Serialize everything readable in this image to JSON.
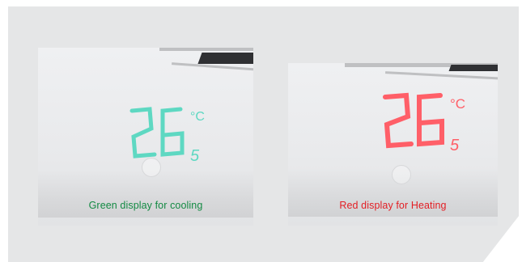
{
  "displays": [
    {
      "mode": "cooling",
      "caption": "Green display for cooling",
      "digits": "26",
      "decimal": "5",
      "unit": "°C",
      "digit_color": "#5ed8c2",
      "caption_color": "#138a43"
    },
    {
      "mode": "heating",
      "caption": "Red display for Heating",
      "digits": "26",
      "decimal": "5",
      "unit": "°C",
      "digit_color": "#ff5f68",
      "caption_color": "#e31e24"
    }
  ],
  "colors": {
    "panel_background": "#e5e6e7",
    "page_background": "#ffffff"
  }
}
